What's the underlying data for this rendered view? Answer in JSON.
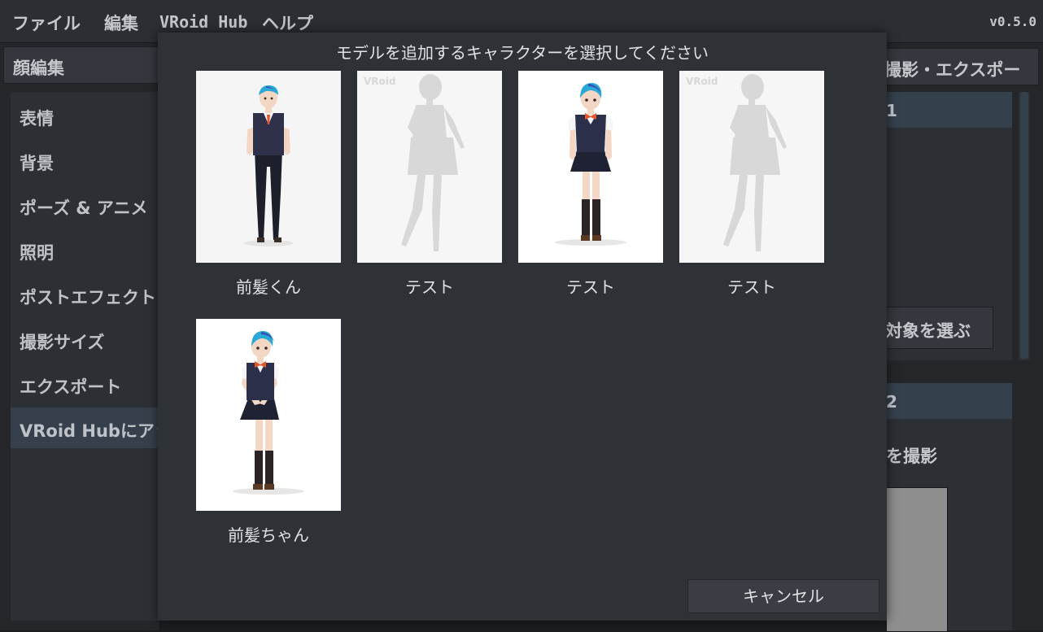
{
  "menubar": {
    "items": [
      "ファイル",
      "編集",
      "VRoid Hub",
      "ヘルプ"
    ],
    "version": "v0.5.0"
  },
  "left_panel": {
    "header": "顔編集",
    "nav_items": [
      "表情",
      "背景",
      "ポーズ & アニメ",
      "照明",
      "ポストエフェクト",
      "撮影サイズ",
      "エクスポート",
      "VRoid Hubにアップ"
    ]
  },
  "right_panel": {
    "header": "撮影・エクスポー",
    "section1": "1",
    "button": "対象を選ぶ",
    "section2": "2",
    "label": "を撮影"
  },
  "modal": {
    "title": "モデルを追加するキャラクターを選択してください",
    "watermark": "VRoid",
    "characters": [
      {
        "name": "前髪くん"
      },
      {
        "name": "テスト"
      },
      {
        "name": "テスト"
      },
      {
        "name": "テスト"
      },
      {
        "name": "前髪ちゃん"
      }
    ],
    "cancel_label": "キャンセル"
  }
}
